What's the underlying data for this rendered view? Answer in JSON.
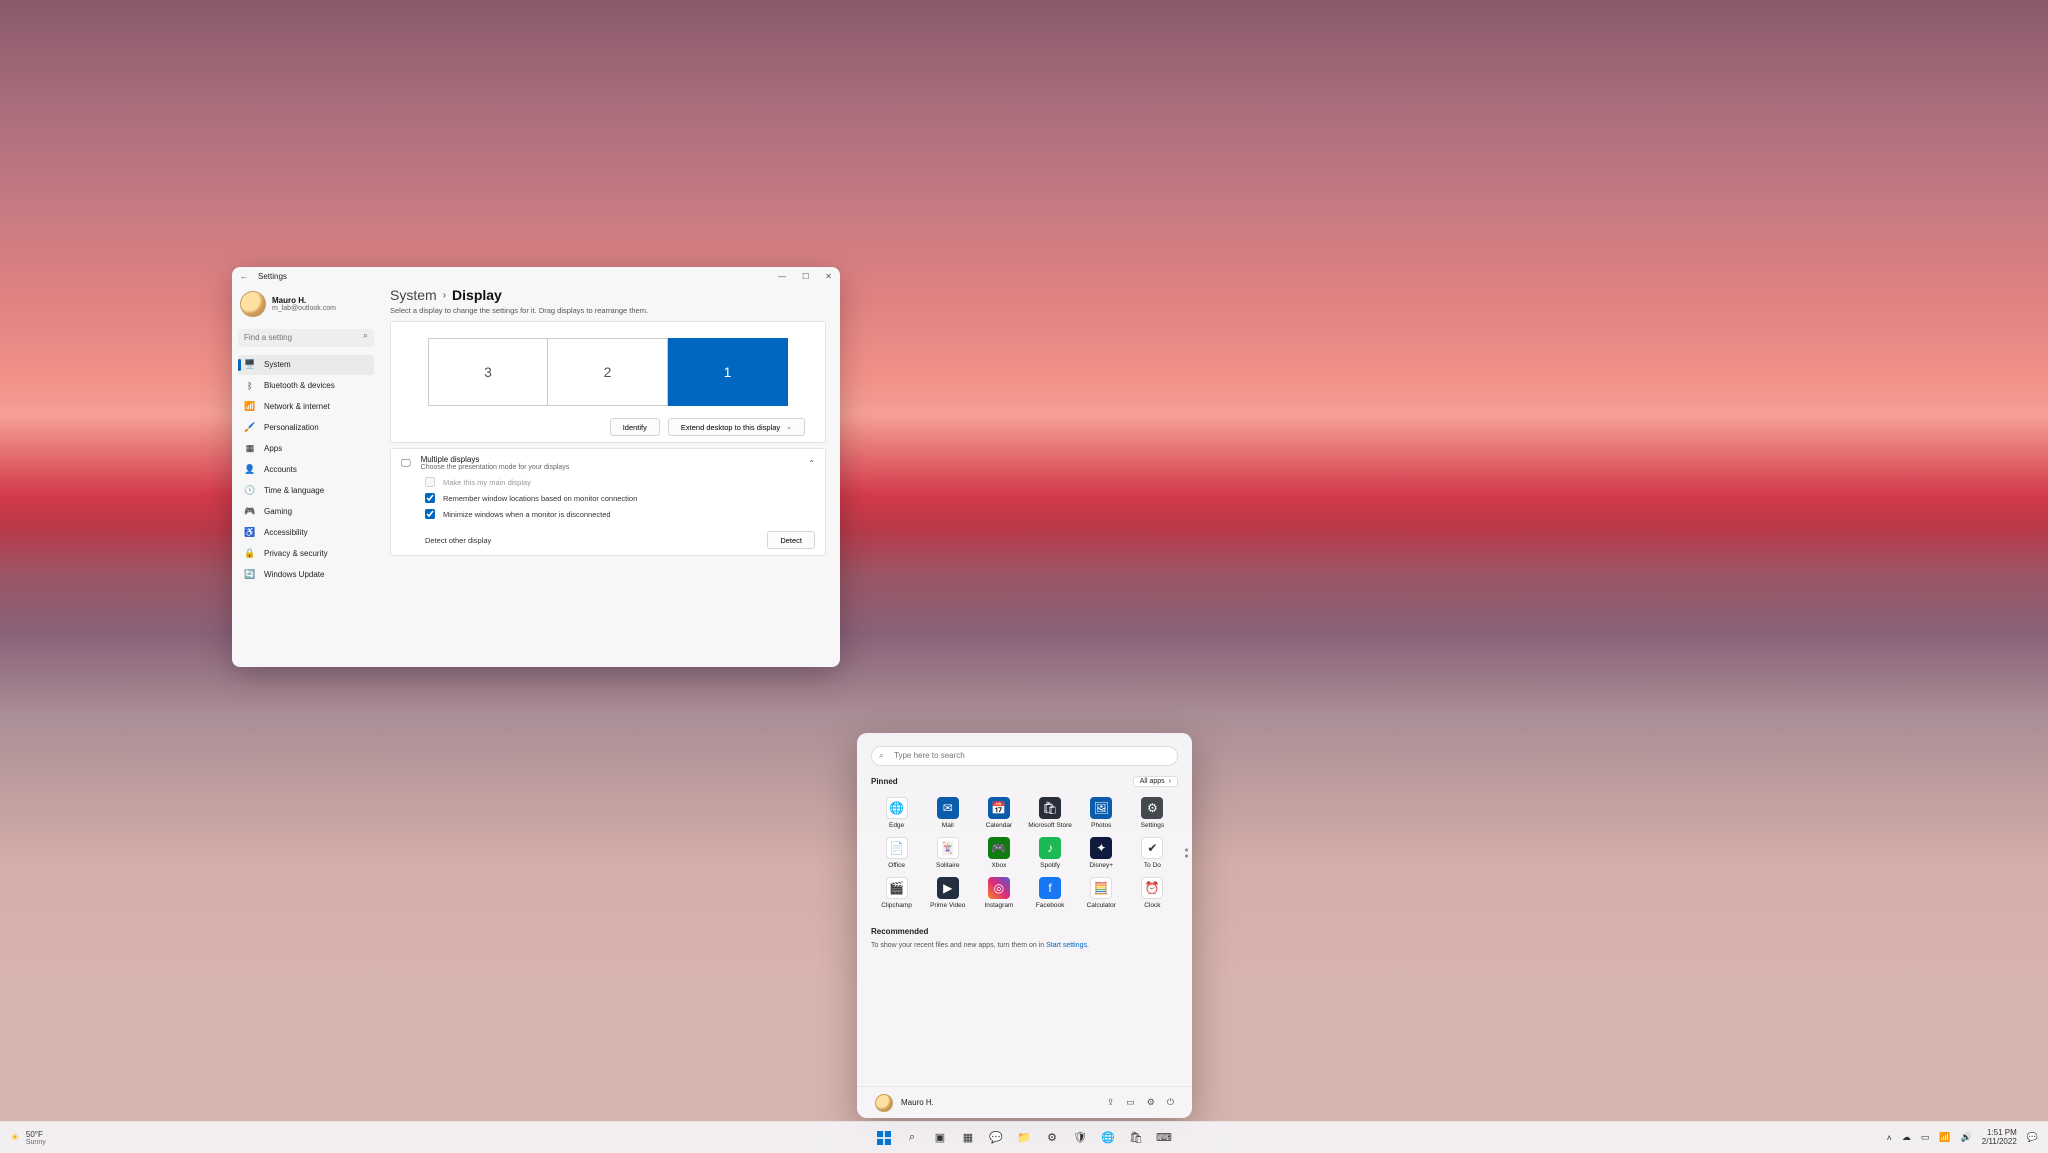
{
  "settings": {
    "appTitle": "Settings",
    "user": {
      "name": "Mauro H.",
      "email": "m_lab@outlook.com"
    },
    "search": {
      "placeholder": "Find a setting"
    },
    "nav": [
      {
        "icon": "🖥️",
        "label": "System",
        "active": true
      },
      {
        "icon": "ᛒ",
        "label": "Bluetooth & devices"
      },
      {
        "icon": "📶",
        "label": "Network & internet"
      },
      {
        "icon": "🖌️",
        "label": "Personalization"
      },
      {
        "icon": "▦",
        "label": "Apps"
      },
      {
        "icon": "👤",
        "label": "Accounts"
      },
      {
        "icon": "🕓",
        "label": "Time & language"
      },
      {
        "icon": "🎮",
        "label": "Gaming"
      },
      {
        "icon": "♿",
        "label": "Accessibility"
      },
      {
        "icon": "🔒",
        "label": "Privacy & security"
      },
      {
        "icon": "🔄",
        "label": "Windows Update"
      }
    ],
    "breadcrumb": {
      "root": "System",
      "page": "Display"
    },
    "pageSubtext": "Select a display to change the settings for it. Drag displays to rearrange them.",
    "monitors": [
      {
        "id": "3",
        "selected": false
      },
      {
        "id": "2",
        "selected": false
      },
      {
        "id": "1",
        "selected": true
      }
    ],
    "identifyBtn": "Identify",
    "extendBtn": "Extend desktop to this display",
    "multiDisplays": {
      "title": "Multiple displays",
      "subtitle": "Choose the presentation mode for your displays",
      "mainDisplay": {
        "label": "Make this my main display",
        "checked": false,
        "disabled": true
      },
      "rememberLoc": {
        "label": "Remember window locations based on monitor connection",
        "checked": true
      },
      "minimizeDisc": {
        "label": "Minimize windows when a monitor is disconnected",
        "checked": true
      },
      "detectLabel": "Detect other display",
      "detectBtn": "Detect"
    }
  },
  "start": {
    "search": {
      "placeholder": "Type here to search"
    },
    "pinnedLabel": "Pinned",
    "allAppsLabel": "All apps",
    "apps": [
      {
        "name": "Edge",
        "bg": "#fff",
        "glyph": "🌐"
      },
      {
        "name": "Mail",
        "bg": "#0b5cab",
        "glyph": "✉"
      },
      {
        "name": "Calendar",
        "bg": "#0b5cab",
        "glyph": "📅"
      },
      {
        "name": "Microsoft Store",
        "bg": "#2a2e3a",
        "glyph": "🛍"
      },
      {
        "name": "Photos",
        "bg": "#0b5cab",
        "glyph": "🖼"
      },
      {
        "name": "Settings",
        "bg": "#44484f",
        "glyph": "⚙"
      },
      {
        "name": "Office",
        "bg": "#fff",
        "glyph": "📄"
      },
      {
        "name": "Solitaire",
        "bg": "#fff",
        "glyph": "🃏"
      },
      {
        "name": "Xbox",
        "bg": "#107c10",
        "glyph": "🎮"
      },
      {
        "name": "Spotify",
        "bg": "#1db954",
        "glyph": "♪"
      },
      {
        "name": "Disney+",
        "bg": "#0f1b3c",
        "glyph": "✦"
      },
      {
        "name": "To Do",
        "bg": "#fff",
        "glyph": "✔"
      },
      {
        "name": "Clipchamp",
        "bg": "#fff",
        "glyph": "🎬"
      },
      {
        "name": "Prime Video",
        "bg": "#232f3e",
        "glyph": "▶"
      },
      {
        "name": "Instagram",
        "bg": "linear-gradient(45deg,#f58529,#dd2a7b,#515bd4)",
        "glyph": "◎"
      },
      {
        "name": "Facebook",
        "bg": "#1877f2",
        "glyph": "f"
      },
      {
        "name": "Calculator",
        "bg": "#fff",
        "glyph": "🧮"
      },
      {
        "name": "Clock",
        "bg": "#fff",
        "glyph": "⏰"
      }
    ],
    "recommendedLabel": "Recommended",
    "recommendedText": "To show your recent files and new apps, turn them on in ",
    "recommendedLink": "Start settings",
    "footerUser": "Mauro H."
  },
  "taskbar": {
    "weather": {
      "temp": "50°F",
      "cond": "Sunny"
    },
    "clock": {
      "time": "1:51 PM",
      "date": "2/11/2022"
    }
  }
}
